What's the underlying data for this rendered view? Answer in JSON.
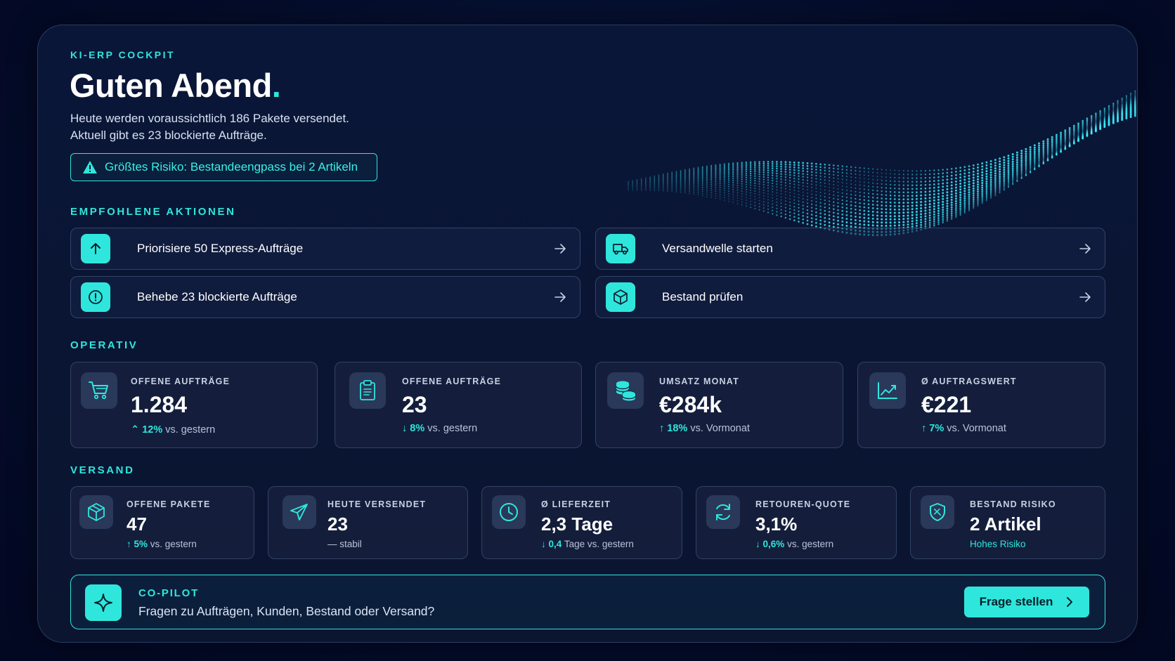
{
  "header": {
    "eyebrow": "KI-ERP COCKPIT",
    "greeting": "Guten Abend",
    "greeting_dot": ".",
    "summary_line1": "Heute werden voraussichtlich 186 Pakete versendet.",
    "summary_line2": "Aktuell gibt es 23 blockierte Aufträge.",
    "risk_banner": "Größtes Risiko: Bestandeengpass bei 2 Artikeln"
  },
  "actions": {
    "title": "EMPFOHLENE AKTIONEN",
    "items": [
      {
        "label": "Priorisiere 50 Express-Aufträge",
        "icon": "arrow-up-icon"
      },
      {
        "label": "Versandwelle starten",
        "icon": "truck-icon"
      },
      {
        "label": "Behebe 23 blockierte Aufträge",
        "icon": "alert-circle-icon"
      },
      {
        "label": "Bestand prüfen",
        "icon": "box-icon"
      }
    ]
  },
  "operativ": {
    "title": "OPERATIV",
    "cards": [
      {
        "label": "OFFENE AUFTRÄGE",
        "value": "1.284",
        "delta_arrow": "⌃",
        "delta_value": "12%",
        "delta_text": "vs. gestern",
        "icon": "cart-icon"
      },
      {
        "label": "OFFENE AUFTRÄGE",
        "value": "23",
        "delta_arrow": "↓",
        "delta_value": "8%",
        "delta_text": "vs. gestern",
        "icon": "clipboard-icon"
      },
      {
        "label": "UMSATZ MONAT",
        "value": "€284k",
        "delta_arrow": "↑",
        "delta_value": "18%",
        "delta_text": "vs. Vormonat",
        "icon": "coins-icon"
      },
      {
        "label": "Ø AUFTRAGSWERT",
        "value": "€221",
        "delta_arrow": "↑",
        "delta_value": "7%",
        "delta_text": "vs. Vormonat",
        "icon": "trend-chart-icon"
      }
    ]
  },
  "versand": {
    "title": "VERSAND",
    "cards": [
      {
        "label": "OFFENE PAKETE",
        "value": "47",
        "delta_arrow": "↑",
        "delta_value": "5%",
        "delta_text": "vs. gestern",
        "icon": "package-icon"
      },
      {
        "label": "HEUTE VERSENDET",
        "value": "23",
        "delta_arrow": "—",
        "delta_value": "",
        "delta_text": "stabil",
        "icon": "send-icon"
      },
      {
        "label": "Ø LIEFERZEIT",
        "value": "2,3 Tage",
        "delta_arrow": "↓",
        "delta_value": "0,4",
        "delta_text": "Tage vs. gestern",
        "icon": "clock-icon"
      },
      {
        "label": "RETOUREN-QUOTE",
        "value": "3,1%",
        "delta_arrow": "↓",
        "delta_value": "0,6%",
        "delta_text": "vs. gestern",
        "icon": "refresh-icon"
      },
      {
        "label": "BESTAND RISIKO",
        "value": "2 Artikel",
        "delta_arrow": "",
        "delta_value": "Hohes Risiko",
        "delta_text": "",
        "icon": "shield-icon"
      }
    ]
  },
  "copilot": {
    "title": "CO-PILOT",
    "prompt": "Fragen zu Aufträgen, Kunden, Bestand oder Versand?",
    "button_label": "Frage stellen"
  },
  "colors": {
    "accent": "#2fe6dc",
    "background": "#040c2a",
    "panel": "#0a1638",
    "text": "#ffffff"
  }
}
